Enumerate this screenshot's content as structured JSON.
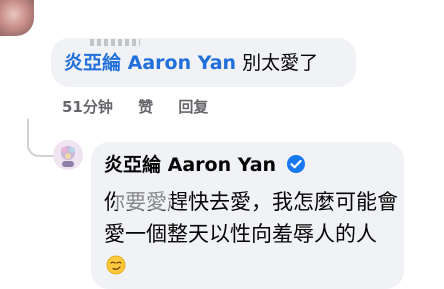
{
  "reply_comment": {
    "author_mention": "炎亞綸 Aaron Yan",
    "text": "別太愛了",
    "time": "51分钟",
    "like_label": "赞",
    "reply_label": "回复"
  },
  "main_comment": {
    "author": "炎亞綸 Aaron Yan",
    "text": "你要愛趕快去愛，我怎麼可能會愛一個整天以性向羞辱人的人",
    "emoji": "smirking-face-emoji"
  },
  "colors": {
    "bubble": "#f0f2f5",
    "mention": "#216fdb",
    "verified": "#1877f2",
    "meta": "#65676b"
  }
}
